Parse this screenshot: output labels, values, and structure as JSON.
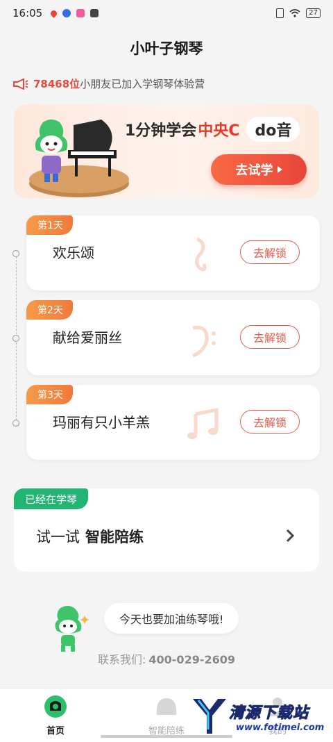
{
  "status_bar": {
    "time": "16:05",
    "battery": "27",
    "icons": [
      "location-icon",
      "paw-icon",
      "app-icon",
      "media-icon",
      "sim-icon",
      "wifi-icon"
    ]
  },
  "header": {
    "title": "小叶子钢琴"
  },
  "notice": {
    "count": "78468位",
    "text": "小朋友已加入学钢琴体验营"
  },
  "banner": {
    "title_prefix": "1分钟学会",
    "title_highlight": "中央C",
    "title_badge": "do音",
    "button_label": "去试学"
  },
  "days": [
    {
      "tag": "第1天",
      "title": "欢乐颂",
      "button": "去解锁"
    },
    {
      "tag": "第2天",
      "title": "献给爱丽丝",
      "button": "去解锁"
    },
    {
      "tag": "第3天",
      "title": "玛丽有只小羊羔",
      "button": "去解锁"
    }
  ],
  "learning": {
    "tag": "已经在学琴",
    "text_prefix": "试一试",
    "text_bold": "智能陪练"
  },
  "cheer": {
    "message": "今天也要加油练琴哦!"
  },
  "contact": {
    "label": "联系我们:",
    "phone": "400-029-2609"
  },
  "tabbar": {
    "items": [
      {
        "label": "首页",
        "active": true
      },
      {
        "label": "智能陪练",
        "active": false
      },
      {
        "label": "我的",
        "active": false
      }
    ]
  },
  "watermark": {
    "title": "清源下载站",
    "url": "www.fotimei.com"
  },
  "colors": {
    "accent_red": "#e33a2a",
    "orange_tag": "#f07a3a",
    "green_tag": "#22b473",
    "background": "#f4f4f5"
  }
}
